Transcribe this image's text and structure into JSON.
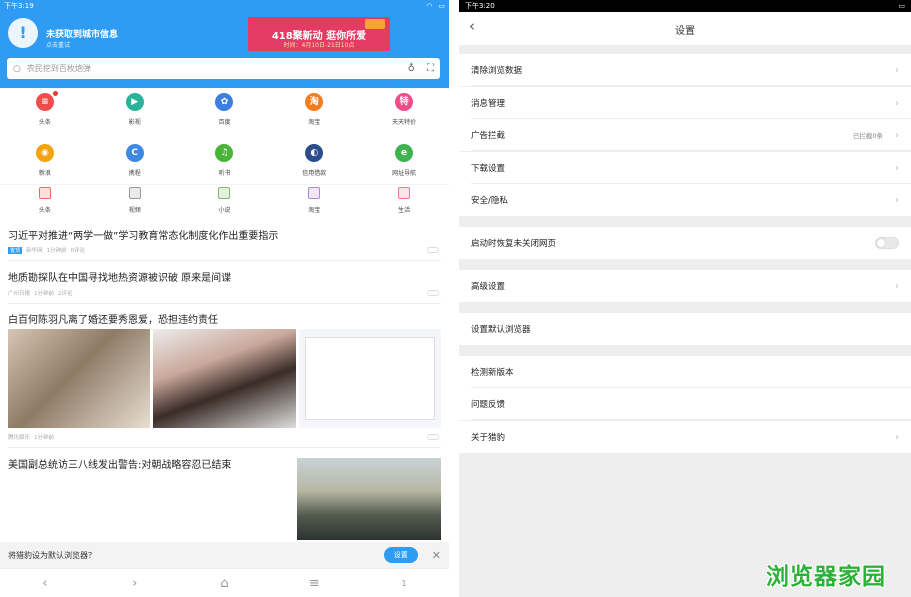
{
  "left": {
    "status": {
      "time": "下午3:19"
    },
    "weather": {
      "title": "未获取到城市信息",
      "subtitle": "点击重试"
    },
    "banner": {
      "line1": "418聚新动 逛你所爱",
      "line2": "时间：4月10日-21日10点"
    },
    "search": {
      "placeholder": "农民挖到百枚炮弹"
    },
    "grid": [
      [
        {
          "label": "头条",
          "icon": "toutiao-icon",
          "color": "#ef4d4d",
          "glyph": "≡",
          "dot": true
        },
        {
          "label": "影视",
          "icon": "video-icon",
          "color": "#2bb39a",
          "glyph": "▶"
        },
        {
          "label": "百度",
          "icon": "baidu-icon",
          "color": "#3d7fe0",
          "glyph": "✿"
        },
        {
          "label": "淘宝",
          "icon": "taobao-icon",
          "color": "#f57c1f",
          "glyph": "淘"
        },
        {
          "label": "天天特价",
          "icon": "tejia-icon",
          "color": "#f04c8a",
          "glyph": "特"
        }
      ],
      [
        {
          "label": "新浪",
          "icon": "sina-icon",
          "color": "#f2a30d",
          "glyph": "◉"
        },
        {
          "label": "携程",
          "icon": "ctrip-icon",
          "color": "#3d88e0",
          "glyph": "C"
        },
        {
          "label": "听书",
          "icon": "audiobook-icon",
          "color": "#4bb33a",
          "glyph": "♫"
        },
        {
          "label": "信用借款",
          "icon": "loan-icon",
          "color": "#2a4d8c",
          "glyph": "◐"
        },
        {
          "label": "网址导航",
          "icon": "nav-icon",
          "color": "#3fb34f",
          "glyph": "e"
        }
      ]
    ],
    "tabs": [
      {
        "label": "头条",
        "icon": "headline-tab-icon",
        "color": "#ef6a5a"
      },
      {
        "label": "视频",
        "icon": "video-tab-icon",
        "color": "#999999"
      },
      {
        "label": "小说",
        "icon": "novel-tab-icon",
        "color": "#7bbf6a"
      },
      {
        "label": "淘宝",
        "icon": "shop-tab-icon",
        "color": "#b088d0"
      },
      {
        "label": "生活",
        "icon": "life-tab-icon",
        "color": "#ef7a9a"
      }
    ],
    "news": [
      {
        "title": "习近平对推进“两学一做”学习教育常态化制度化作出重要指示",
        "badge": "置顶",
        "source": "新华网",
        "time": "1分钟前",
        "comments": "0评论"
      },
      {
        "title": "地质勘探队在中国寻找地热资源被识破 原来是间谍",
        "source": "广州日报",
        "time": "1分钟前",
        "comments": "2评论"
      },
      {
        "title": "白百何陈羽凡离了婚还要秀恩爱，恐担违约责任",
        "source": "腾讯娱乐",
        "time": "1分钟前"
      },
      {
        "title": "美国副总统访三八线发出警告:对朝战略容忍已结束"
      }
    ],
    "default_prompt": {
      "text": "将猎豹设为默认浏览器？",
      "button": "设置"
    },
    "nav": [
      "‹",
      "›",
      "⌂",
      "≡",
      "1"
    ]
  },
  "right": {
    "status": {
      "time": "下午3:20"
    },
    "header": {
      "title": "设置",
      "back": "‹"
    },
    "items": [
      {
        "label": "清除浏览数据"
      },
      {
        "label": "消息管理"
      },
      {
        "label": "广告拦截",
        "value": "已拦截0条"
      },
      {
        "label": "下载设置"
      },
      {
        "label": "安全/隐私"
      },
      {
        "label": "启动时恢复未关闭网页"
      },
      {
        "label": "高级设置"
      },
      {
        "label": "设置默认浏览器"
      },
      {
        "label": "检测新版本"
      },
      {
        "label": "问题反馈"
      },
      {
        "label": "关于猎豹"
      }
    ]
  },
  "watermark": "浏览器家园"
}
